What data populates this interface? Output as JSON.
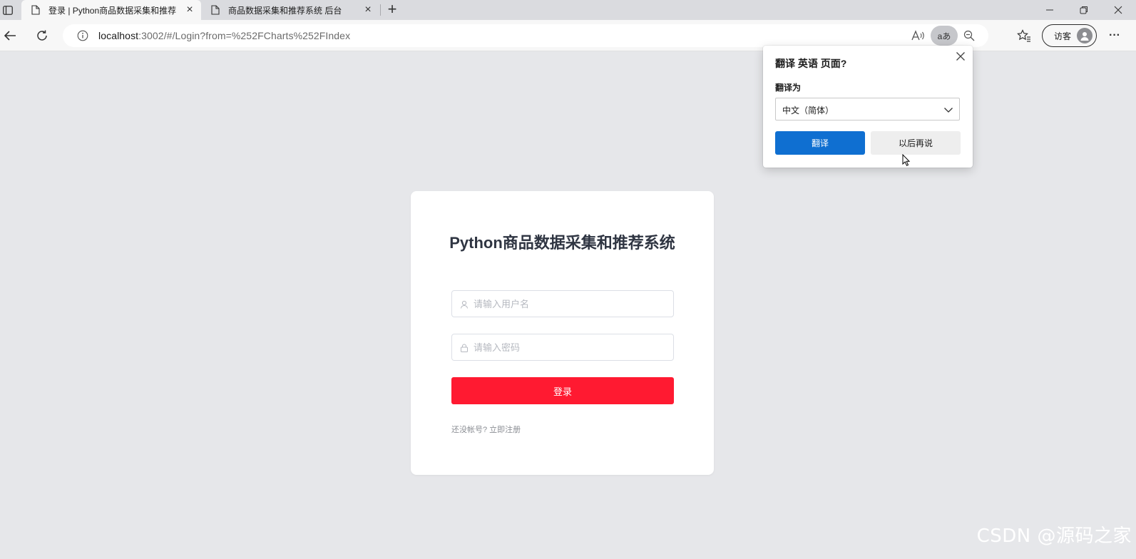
{
  "browser": {
    "tabs": [
      {
        "title": "登录 | Python商品数据采集和推荐",
        "active": true
      },
      {
        "title": "商品数据采集和推荐系统 后台",
        "active": false
      }
    ],
    "address": {
      "host": "localhost",
      "rest": ":3002/#/Login?from=%252FCharts%252FIndex"
    },
    "translate_icon_text": "aあ",
    "profile_label": "访客",
    "more_label": "···"
  },
  "login": {
    "title": "Python商品数据采集和推荐系统",
    "username_placeholder": "请输入用户名",
    "password_placeholder": "请输入密码",
    "submit_label": "登录",
    "register_text": "还没帐号? 立即注册"
  },
  "translate_popup": {
    "title": "翻译 英语 页面?",
    "target_label": "翻译为",
    "selected_language": "中文（简体）",
    "translate_button": "翻译",
    "later_button": "以后再说"
  },
  "watermark": "CSDN @源码之家",
  "colors": {
    "page_bg": "#e6e7ea",
    "login_button": "#ff1a31",
    "translate_button": "#0f6fd1"
  }
}
